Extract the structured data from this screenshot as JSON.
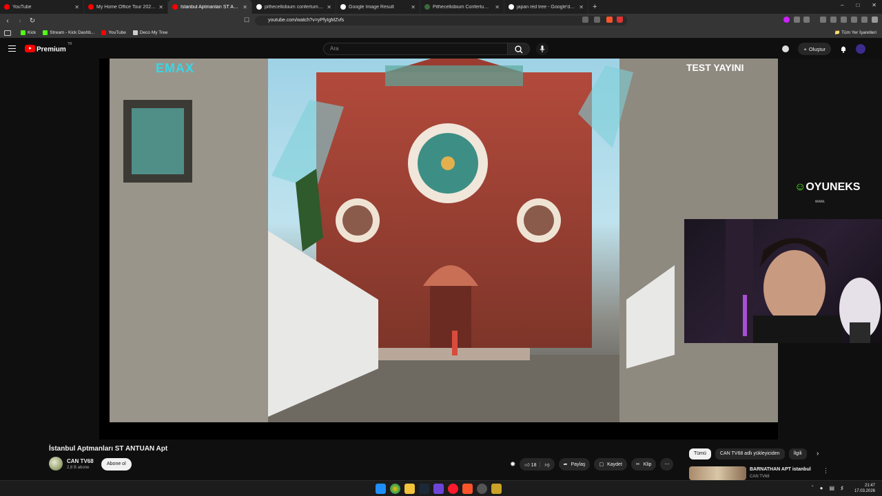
{
  "browser": {
    "tabs": [
      {
        "title": "YouTube",
        "favicon": "#ff0000",
        "active": false
      },
      {
        "title": "My Home Office Tour 2025 | Content...",
        "favicon": "#ff0000",
        "active": false
      },
      {
        "title": "İstanbul Aptmanları ST ANTUA...",
        "favicon": "#ff0000",
        "active": true
      },
      {
        "title": "pithecellobium confertum - Google...",
        "favicon": "#ffffff",
        "active": false
      },
      {
        "title": "Google Image Result",
        "favicon": "#ffffff",
        "active": false
      },
      {
        "title": "Pithecellobium Confertum 'Everfresh'...",
        "favicon": "#3a6b3a",
        "active": false
      },
      {
        "title": "japan red tree - Google'da Ara",
        "favicon": "#ffffff",
        "active": false
      }
    ],
    "url": "youtube.com/watch?v=yPfyIgMZvfs",
    "bookmarks": [
      {
        "label": "Kick",
        "color": "#53fc18"
      },
      {
        "label": "Stream - Kick Dashb...",
        "color": "#53fc18"
      },
      {
        "label": "YouTube",
        "color": "#ff0000"
      },
      {
        "label": "Deco My Tree",
        "color": "#cccccc"
      }
    ],
    "all_bookmarks": "Tüm Yer İşaretleri"
  },
  "youtube": {
    "brand": "Premium",
    "region": "TR",
    "search_placeholder": "Ara",
    "create_label": "Oluştur"
  },
  "video": {
    "overlay_left": "EMAX",
    "overlay_right": "TEST YAYINI",
    "sponsor": "OYUNEKS",
    "sponsor_sub": "www.",
    "title": "İstanbul Aptmanları ST ANTUAN Apt",
    "channel": "CAN TV68",
    "subscribers": "2,8 B abone",
    "subscribe_label": "Abone ol",
    "likes": "18",
    "share_label": "Paylaş",
    "save_label": "Kaydet",
    "clip_label": "Klip"
  },
  "sidebar": {
    "chips": [
      "Tümü",
      "CAN TV68 adlı yükleyiciden",
      "İlgili"
    ],
    "rec_title": "BARNATHAN APT istanbul",
    "rec_channel": "CAN TV68"
  },
  "taskbar": {
    "time": "21:47",
    "date": "17.03.2026"
  }
}
